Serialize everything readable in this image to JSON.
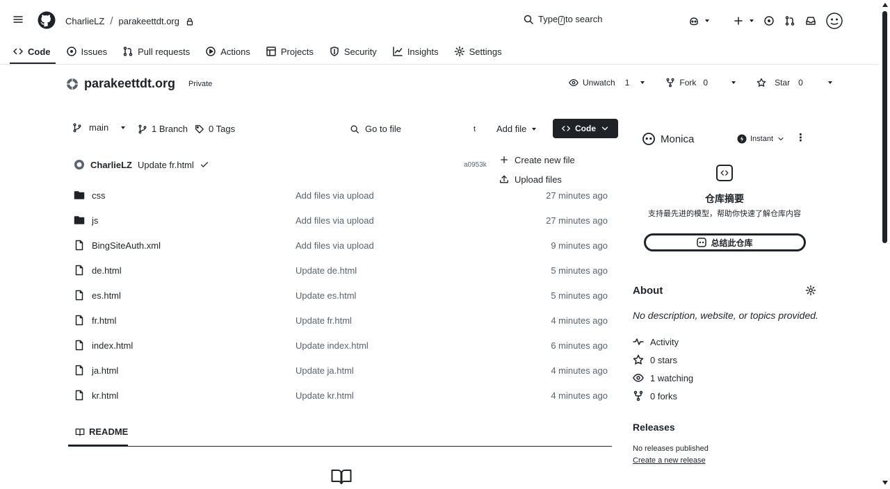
{
  "header": {
    "owner": "CharlieLZ",
    "separator": "/",
    "repo": "parakeettdt.org",
    "search_prefix": "Type",
    "search_key": "/",
    "search_suffix": "to search"
  },
  "nav": {
    "tabs": [
      {
        "label": "Code",
        "icon": "code-icon"
      },
      {
        "label": "Issues",
        "icon": "issue-icon"
      },
      {
        "label": "Pull requests",
        "icon": "pull-request-icon"
      },
      {
        "label": "Actions",
        "icon": "play-icon"
      },
      {
        "label": "Projects",
        "icon": "table-icon"
      },
      {
        "label": "Security",
        "icon": "shield-icon"
      },
      {
        "label": "Insights",
        "icon": "graph-icon"
      },
      {
        "label": "Settings",
        "icon": "gear-icon"
      }
    ]
  },
  "repo": {
    "name": "parakeettdt.org",
    "visibility": "Private",
    "watch_label": "Unwatch",
    "watch_count": "1",
    "fork_label": "Fork",
    "fork_count": "0",
    "star_label": "Star",
    "star_count": "0"
  },
  "toolbar": {
    "branch": "main",
    "branch_count": "1 Branch",
    "tag_count": "0 Tags",
    "go_to_file": "Go to file",
    "go_to_file_key": "t",
    "add_file": "Add file",
    "code": "Code"
  },
  "add_file_menu": {
    "items": [
      {
        "label": "Create new file",
        "icon": "plus-icon"
      },
      {
        "label": "Upload files",
        "icon": "upload-icon"
      }
    ]
  },
  "commit": {
    "author": "CharlieLZ",
    "message": "Update fr.html",
    "hash": "a0953k"
  },
  "files": [
    {
      "name": "css",
      "type": "folder",
      "message": "Add files via upload",
      "time": "27 minutes ago"
    },
    {
      "name": "js",
      "type": "folder",
      "message": "Add files via upload",
      "time": "27 minutes ago"
    },
    {
      "name": "BingSiteAuth.xml",
      "type": "file",
      "message": "Add files via upload",
      "time": "9 minutes ago"
    },
    {
      "name": "de.html",
      "type": "file",
      "message": "Update de.html",
      "time": "5 minutes ago"
    },
    {
      "name": "es.html",
      "type": "file",
      "message": "Update es.html",
      "time": "5 minutes ago"
    },
    {
      "name": "fr.html",
      "type": "file",
      "message": "Update fr.html",
      "time": "4 minutes ago"
    },
    {
      "name": "index.html",
      "type": "file",
      "message": "Update index.html",
      "time": "6 minutes ago"
    },
    {
      "name": "ja.html",
      "type": "file",
      "message": "Update ja.html",
      "time": "4 minutes ago"
    },
    {
      "name": "kr.html",
      "type": "file",
      "message": "Update kr.html",
      "time": "4 minutes ago"
    }
  ],
  "readme": {
    "label": "README"
  },
  "monica": {
    "name": "Monica",
    "mode": "Instant",
    "title": "仓库摘要",
    "subtitle": "支持最先进的模型，帮助你快速了解仓库内容",
    "button": "总结此仓库"
  },
  "about": {
    "title": "About",
    "description": "No description, website, or topics provided.",
    "stats": [
      {
        "label": "Activity",
        "icon": "pulse-icon"
      },
      {
        "label": "0 stars",
        "icon": "star-icon"
      },
      {
        "label": "1 watching",
        "icon": "eye-icon"
      },
      {
        "label": "0 forks",
        "icon": "fork-icon"
      }
    ]
  },
  "releases": {
    "title": "Releases",
    "none": "No releases published",
    "create": "Create a new release"
  }
}
